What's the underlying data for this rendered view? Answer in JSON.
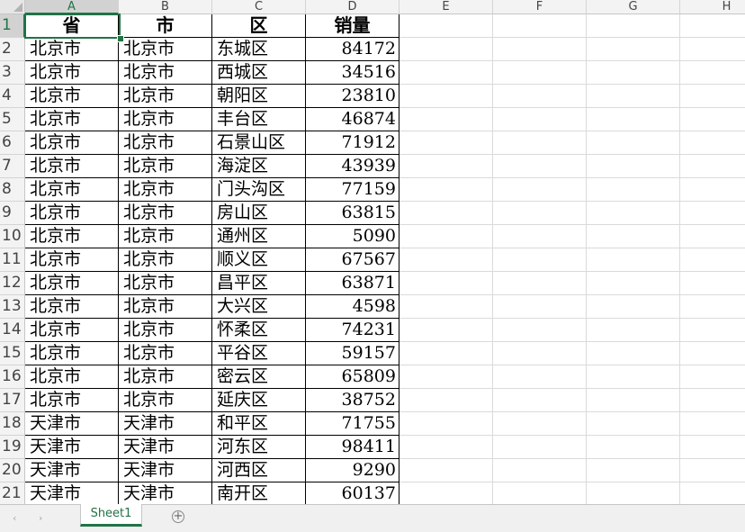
{
  "sheet": {
    "columns": [
      "A",
      "B",
      "C",
      "D",
      "E",
      "F",
      "G",
      "H"
    ],
    "rows": [
      [
        "省",
        "市",
        "区",
        "销量"
      ],
      [
        "北京市",
        "北京市",
        "东城区",
        "84172"
      ],
      [
        "北京市",
        "北京市",
        "西城区",
        "34516"
      ],
      [
        "北京市",
        "北京市",
        "朝阳区",
        "23810"
      ],
      [
        "北京市",
        "北京市",
        "丰台区",
        "46874"
      ],
      [
        "北京市",
        "北京市",
        "石景山区",
        "71912"
      ],
      [
        "北京市",
        "北京市",
        "海淀区",
        "43939"
      ],
      [
        "北京市",
        "北京市",
        "门头沟区",
        "77159"
      ],
      [
        "北京市",
        "北京市",
        "房山区",
        "63815"
      ],
      [
        "北京市",
        "北京市",
        "通州区",
        "5090"
      ],
      [
        "北京市",
        "北京市",
        "顺义区",
        "67567"
      ],
      [
        "北京市",
        "北京市",
        "昌平区",
        "63871"
      ],
      [
        "北京市",
        "北京市",
        "大兴区",
        "4598"
      ],
      [
        "北京市",
        "北京市",
        "怀柔区",
        "74231"
      ],
      [
        "北京市",
        "北京市",
        "平谷区",
        "59157"
      ],
      [
        "北京市",
        "北京市",
        "密云区",
        "65809"
      ],
      [
        "北京市",
        "北京市",
        "延庆区",
        "38752"
      ],
      [
        "天津市",
        "天津市",
        "和平区",
        "71755"
      ],
      [
        "天津市",
        "天津市",
        "河东区",
        "98411"
      ],
      [
        "天津市",
        "天津市",
        "河西区",
        "9290"
      ],
      [
        "天津市",
        "天津市",
        "南开区",
        "60137"
      ]
    ],
    "selected_cell": "A1",
    "accent_color": "#217346"
  },
  "tabs": {
    "sheet_name": "Sheet1",
    "prev_icon": "‹",
    "next_icon": "›",
    "add_icon": "+"
  }
}
